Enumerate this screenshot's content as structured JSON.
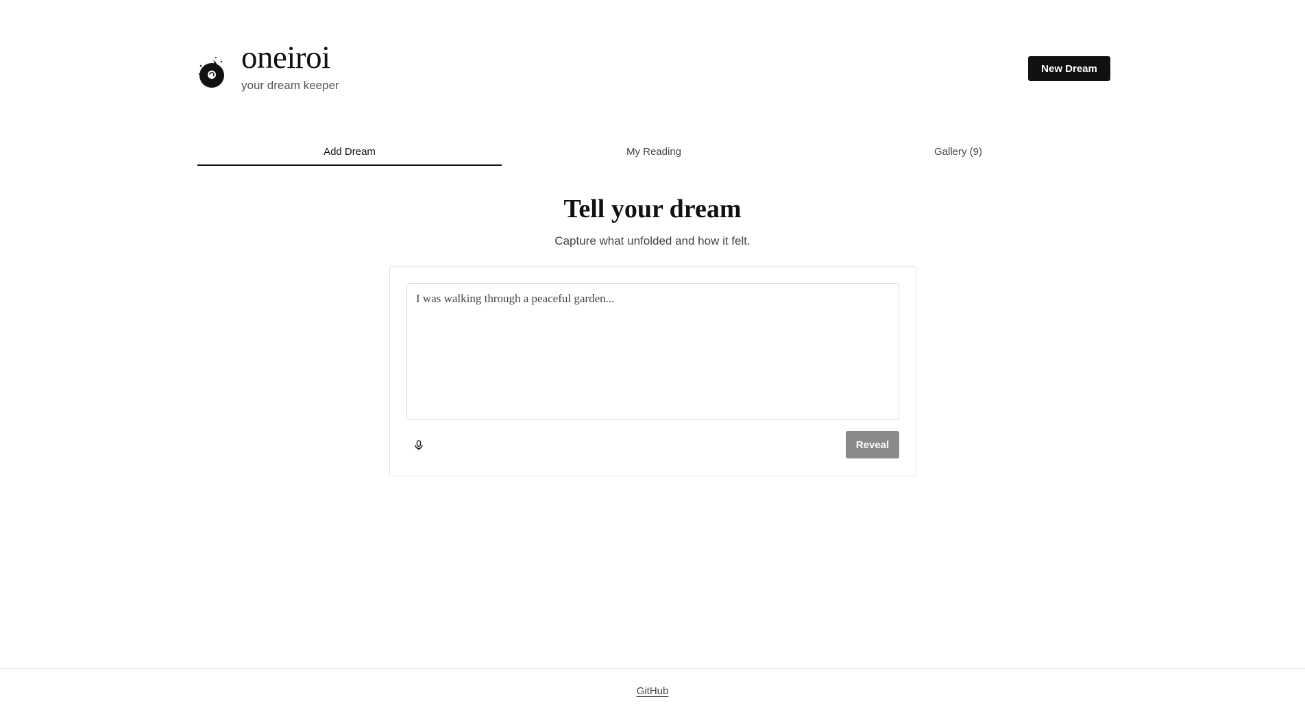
{
  "header": {
    "title": "oneiroi",
    "subtitle": "your dream keeper",
    "logo_icon": "moon-dreamer-logo",
    "new_dream_label": "New Dream"
  },
  "tabs": [
    {
      "label": "Add Dream",
      "active": true
    },
    {
      "label": "My Reading",
      "active": false
    },
    {
      "label": "Gallery (9)",
      "active": false
    }
  ],
  "main": {
    "heading": "Tell your dream",
    "subheading": "Capture what unfolded and how it felt.",
    "input": {
      "placeholder": "I was walking through a peaceful garden...",
      "value": ""
    },
    "mic_icon": "microphone-icon",
    "reveal_label": "Reveal"
  },
  "footer": {
    "link_label": "GitHub"
  },
  "colors": {
    "primary": "#111111",
    "disabled_button": "#8a8a8a",
    "border": "#e3e3e3"
  }
}
